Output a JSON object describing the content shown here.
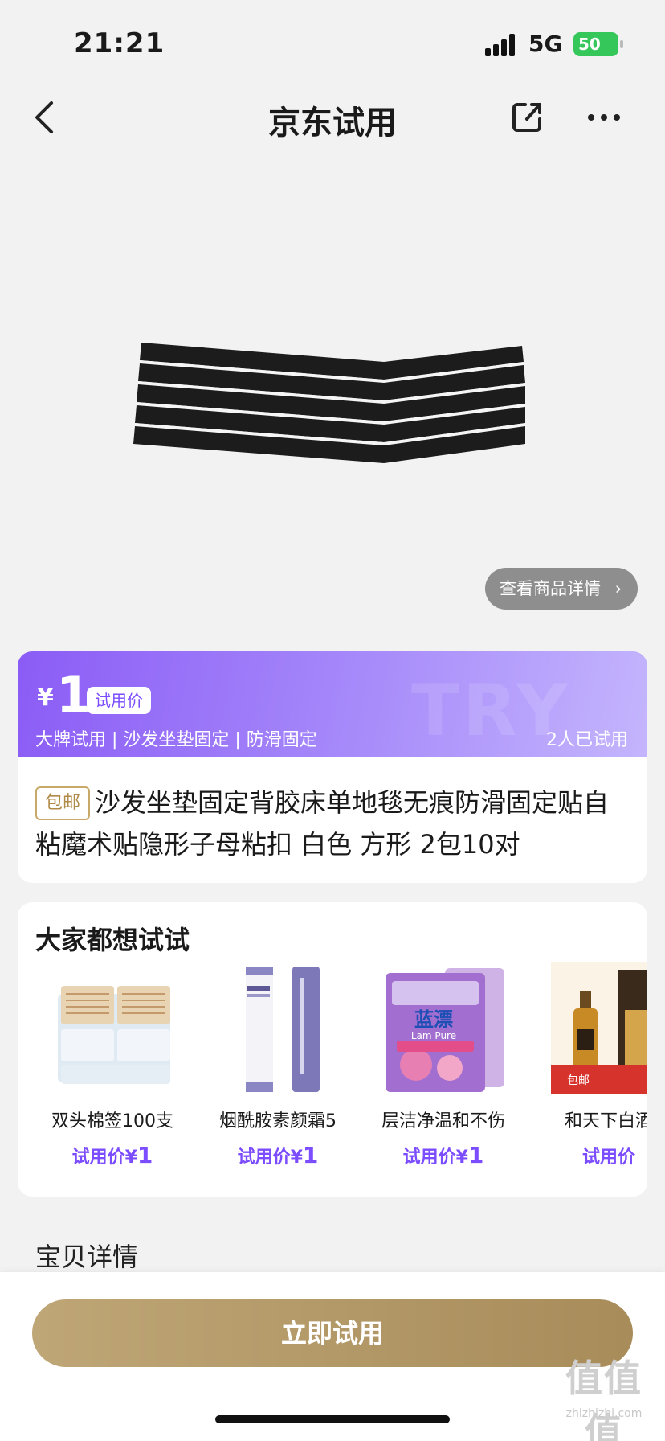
{
  "status_bar": {
    "time": "21:21",
    "network": "5G",
    "battery": "50"
  },
  "nav": {
    "title": "京东试用"
  },
  "product": {
    "detail_link": "查看商品详情",
    "currency": "¥",
    "price": "1",
    "price_tag": "试用价",
    "features": "大牌试用 | 沙发坐垫固定 | 防滑固定",
    "tried_count": "2人已试用",
    "watermark": "TRY",
    "free_shipping": "包邮",
    "title": "沙发坐垫固定背胶床单地毯无痕防滑固定贴自粘魔术贴隐形子母粘扣 白色 方形 2包10对"
  },
  "recommend": {
    "title": "大家都想试试",
    "items": [
      {
        "name": "双头棉签100支",
        "price_label": "试用价¥",
        "price": "1",
        "image": "cotton-swab-pack"
      },
      {
        "name": "烟酰胺素颜霜5",
        "price_label": "试用价¥",
        "price": "1",
        "image": "cream-tube"
      },
      {
        "name": "层洁净温和不伤",
        "price_label": "试用价¥",
        "price": "1",
        "image": "laundry-powder-bag"
      },
      {
        "name": "和天下白酒",
        "price_label": "试用价",
        "price": "",
        "image": "liquor-bottle"
      }
    ],
    "pack_brand_line1": "蓝漂",
    "pack_brand_line2": "Lam Pure",
    "liquor_badge": "包邮"
  },
  "section": {
    "detail_heading": "宝贝详情"
  },
  "bottom": {
    "cta": "立即试用",
    "watermark": "值值值",
    "url": "zhizhizhi.com"
  },
  "colors": {
    "accent": "#7c4dff",
    "gold": "#b39a68",
    "battery": "#35c759"
  }
}
